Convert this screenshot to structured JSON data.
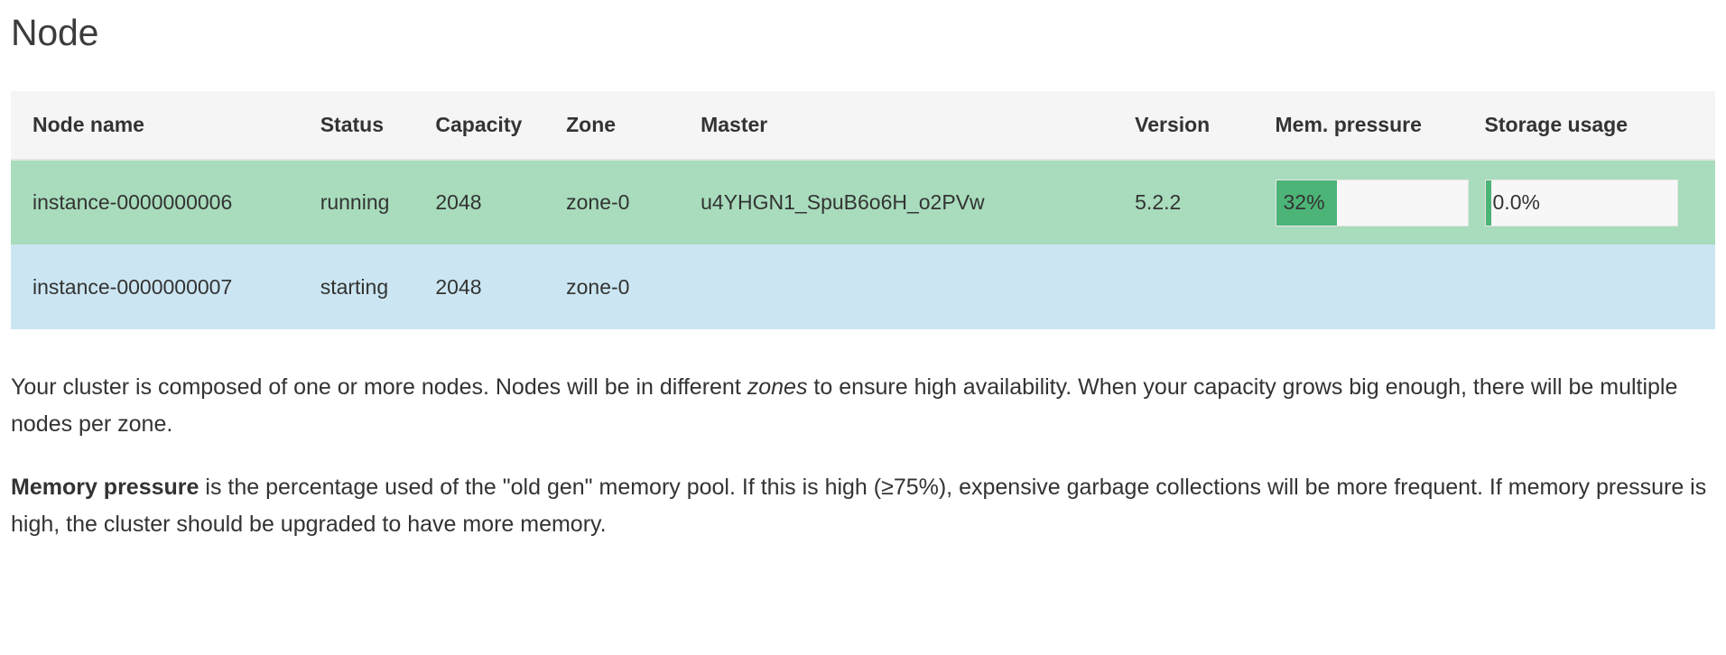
{
  "page": {
    "title": "Node"
  },
  "table": {
    "columns": [
      "Node name",
      "Status",
      "Capacity",
      "Zone",
      "Master",
      "Version",
      "Mem. pressure",
      "Storage usage"
    ],
    "rows": [
      {
        "node_name": "instance-0000000006",
        "status": "running",
        "capacity": "2048",
        "zone": "zone-0",
        "master": "u4YHGN1_SpuB6o6H_o2PVw",
        "version": "5.2.2",
        "mem_pressure": "32%",
        "mem_pressure_value": 32,
        "storage_usage": "0.0%",
        "storage_usage_value": 0.0,
        "row_color": "#a8dcbc"
      },
      {
        "node_name": "instance-0000000007",
        "status": "starting",
        "capacity": "2048",
        "zone": "zone-0",
        "master": "",
        "version": "",
        "mem_pressure": "",
        "storage_usage": "",
        "row_color": "#cbe6f2"
      }
    ]
  },
  "colors": {
    "header_bg": "#f5f5f5",
    "row_running": "#a8dcbc",
    "row_starting": "#cbe6f2",
    "bar_fill": "#4cb477",
    "bar_track": "#f7f7f7"
  },
  "prose": {
    "p1_part1": "Your cluster is composed of one or more nodes. Nodes will be in different ",
    "p1_italic": "zones",
    "p1_part2": " to ensure high availability. When your capacity grows big enough, there will be multiple nodes per zone.",
    "p2_bold": "Memory pressure",
    "p2_rest": " is the percentage used of the \"old gen\" memory pool. If this is high (≥75%), expensive garbage collections will be more frequent. If memory pressure is high, the cluster should be upgraded to have more memory."
  }
}
